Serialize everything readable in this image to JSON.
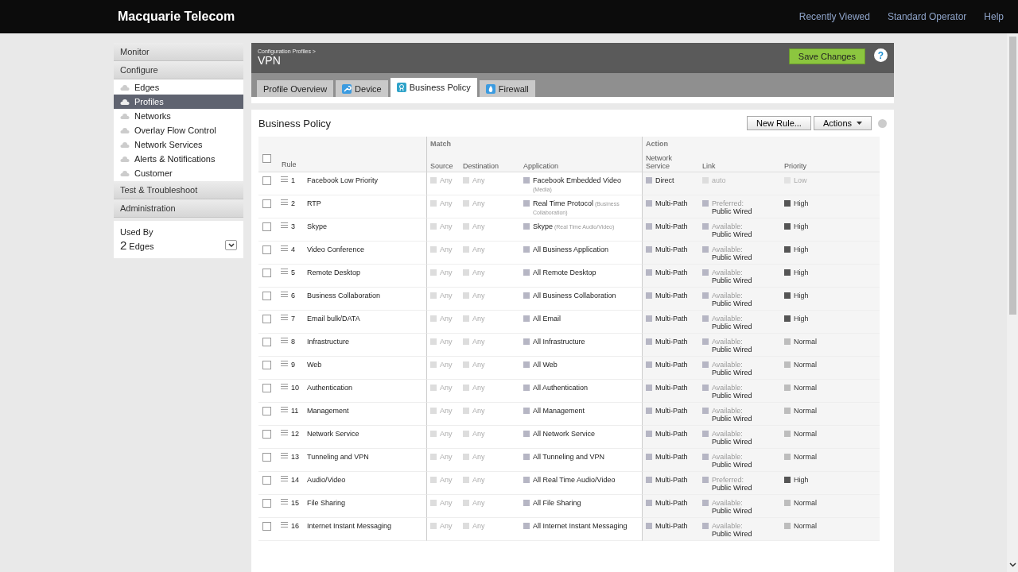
{
  "header": {
    "brand": "Macquarie Telecom",
    "links": [
      "Recently Viewed",
      "Standard Operator",
      "Help"
    ]
  },
  "sidebar": {
    "sections": [
      {
        "label": "Monitor"
      },
      {
        "label": "Configure",
        "items": [
          {
            "label": "Edges",
            "selected": false
          },
          {
            "label": "Profiles",
            "selected": true
          },
          {
            "label": "Networks",
            "selected": false
          },
          {
            "label": "Overlay Flow Control",
            "selected": false
          },
          {
            "label": "Network Services",
            "selected": false
          },
          {
            "label": "Alerts & Notifications",
            "selected": false
          },
          {
            "label": "Customer",
            "selected": false
          }
        ]
      },
      {
        "label": "Test & Troubleshoot"
      },
      {
        "label": "Administration"
      }
    ],
    "used_by": {
      "label": "Used By",
      "count": "2",
      "unit": "Edges"
    }
  },
  "profile": {
    "breadcrumb": "Configuration Profiles >",
    "title": "VPN",
    "save": "Save Changes",
    "help": "?",
    "tabs": [
      {
        "label": "Profile Overview",
        "kind": "plain",
        "selected": false
      },
      {
        "label": "Device",
        "kind": "device",
        "selected": false
      },
      {
        "label": "Business Policy",
        "kind": "policy",
        "selected": true
      },
      {
        "label": "Firewall",
        "kind": "firewall",
        "selected": false
      }
    ]
  },
  "policy": {
    "title": "Business Policy",
    "new_rule": "New Rule...",
    "actions": "Actions",
    "select_all_checked": false,
    "groups": [
      "Match",
      "Action"
    ],
    "columns": {
      "rule": "Rule",
      "source": "Source",
      "destination": "Destination",
      "application": "Application",
      "network_service": "Network Service",
      "link": "Link",
      "priority": "Priority"
    },
    "rows": [
      {
        "checked": false,
        "number": "1",
        "name": "Facebook Low Priority",
        "source": "Any",
        "destination": "Any",
        "application": "Facebook Embedded Video",
        "category": "(Media)",
        "service": "Direct",
        "link": "auto",
        "link_enabled": false,
        "priority": "Low",
        "color": "#e2e2e2"
      },
      {
        "checked": false,
        "number": "2",
        "name": "RTP",
        "source": "Any",
        "destination": "Any",
        "application": "Real Time Protocol",
        "category": "(Business Collaboration)",
        "service": "Multi-Path",
        "link_status": "Preferred:",
        "link": "Public Wired",
        "link_enabled": true,
        "priority": "High",
        "color": "#555555"
      },
      {
        "checked": false,
        "number": "3",
        "name": "Skype",
        "source": "Any",
        "destination": "Any",
        "application": "Skype",
        "category": "(Real Time Audio/Video)",
        "service": "Multi-Path",
        "link_status": "Available:",
        "link": "Public Wired",
        "link_enabled": true,
        "priority": "High",
        "color": "#555555"
      },
      {
        "checked": false,
        "number": "4",
        "name": "Video Conference",
        "source": "Any",
        "destination": "Any",
        "application": "All Business Application",
        "service": "Multi-Path",
        "link_status": "Available:",
        "link": "Public Wired",
        "link_enabled": true,
        "priority": "High",
        "color": "#555555"
      },
      {
        "checked": false,
        "number": "5",
        "name": "Remote Desktop",
        "source": "Any",
        "destination": "Any",
        "application": "All Remote Desktop",
        "service": "Multi-Path",
        "link_status": "Available:",
        "link": "Public Wired",
        "link_enabled": true,
        "priority": "High",
        "color": "#555555"
      },
      {
        "checked": false,
        "number": "6",
        "name": "Business Collaboration",
        "source": "Any",
        "destination": "Any",
        "application": "All Business Collaboration",
        "service": "Multi-Path",
        "link_status": "Available:",
        "link": "Public Wired",
        "link_enabled": true,
        "priority": "High",
        "color": "#555555"
      },
      {
        "checked": false,
        "number": "7",
        "name": "Email bulk/DATA",
        "source": "Any",
        "destination": "Any",
        "application": "All Email",
        "service": "Multi-Path",
        "link_status": "Available:",
        "link": "Public Wired",
        "link_enabled": true,
        "priority": "High",
        "color": "#555555"
      },
      {
        "checked": false,
        "number": "8",
        "name": "Infrastructure",
        "source": "Any",
        "destination": "Any",
        "application": "All Infrastructure",
        "service": "Multi-Path",
        "link_status": "Available:",
        "link": "Public Wired",
        "link_enabled": true,
        "priority": "Normal",
        "color": "#bdbdbd"
      },
      {
        "checked": false,
        "number": "9",
        "name": "Web",
        "source": "Any",
        "destination": "Any",
        "application": "All Web",
        "service": "Multi-Path",
        "link_status": "Available:",
        "link": "Public Wired",
        "link_enabled": true,
        "priority": "Normal",
        "color": "#bdbdbd"
      },
      {
        "checked": false,
        "number": "10",
        "name": "Authentication",
        "source": "Any",
        "destination": "Any",
        "application": "All Authentication",
        "service": "Multi-Path",
        "link_status": "Available:",
        "link": "Public Wired",
        "link_enabled": true,
        "priority": "Normal",
        "color": "#bdbdbd"
      },
      {
        "checked": false,
        "number": "11",
        "name": "Management",
        "source": "Any",
        "destination": "Any",
        "application": "All Management",
        "service": "Multi-Path",
        "link_status": "Available:",
        "link": "Public Wired",
        "link_enabled": true,
        "priority": "Normal",
        "color": "#bdbdbd"
      },
      {
        "checked": false,
        "number": "12",
        "name": "Network Service",
        "source": "Any",
        "destination": "Any",
        "application": "All Network Service",
        "service": "Multi-Path",
        "link_status": "Available:",
        "link": "Public Wired",
        "link_enabled": true,
        "priority": "Normal",
        "color": "#bdbdbd"
      },
      {
        "checked": false,
        "number": "13",
        "name": "Tunneling and VPN",
        "source": "Any",
        "destination": "Any",
        "application": "All Tunneling and VPN",
        "service": "Multi-Path",
        "link_status": "Available:",
        "link": "Public Wired",
        "link_enabled": true,
        "priority": "Normal",
        "color": "#bdbdbd"
      },
      {
        "checked": false,
        "number": "14",
        "name": "Audio/Video",
        "source": "Any",
        "destination": "Any",
        "application": "All Real Time Audio/Video",
        "service": "Multi-Path",
        "link_status": "Preferred:",
        "link": "Public Wired",
        "link_enabled": true,
        "priority": "High",
        "color": "#555555"
      },
      {
        "checked": false,
        "number": "15",
        "name": "File Sharing",
        "source": "Any",
        "destination": "Any",
        "application": "All File Sharing",
        "service": "Multi-Path",
        "link_status": "Available:",
        "link": "Public Wired",
        "link_enabled": true,
        "priority": "Normal",
        "color": "#bdbdbd"
      },
      {
        "checked": false,
        "number": "16",
        "name": "Internet Instant Messaging",
        "source": "Any",
        "destination": "Any",
        "application": "All Internet Instant Messaging",
        "service": "Multi-Path",
        "link_status": "Available:",
        "link": "Public Wired",
        "link_enabled": true,
        "priority": "Normal",
        "color": "#bdbdbd"
      }
    ]
  }
}
